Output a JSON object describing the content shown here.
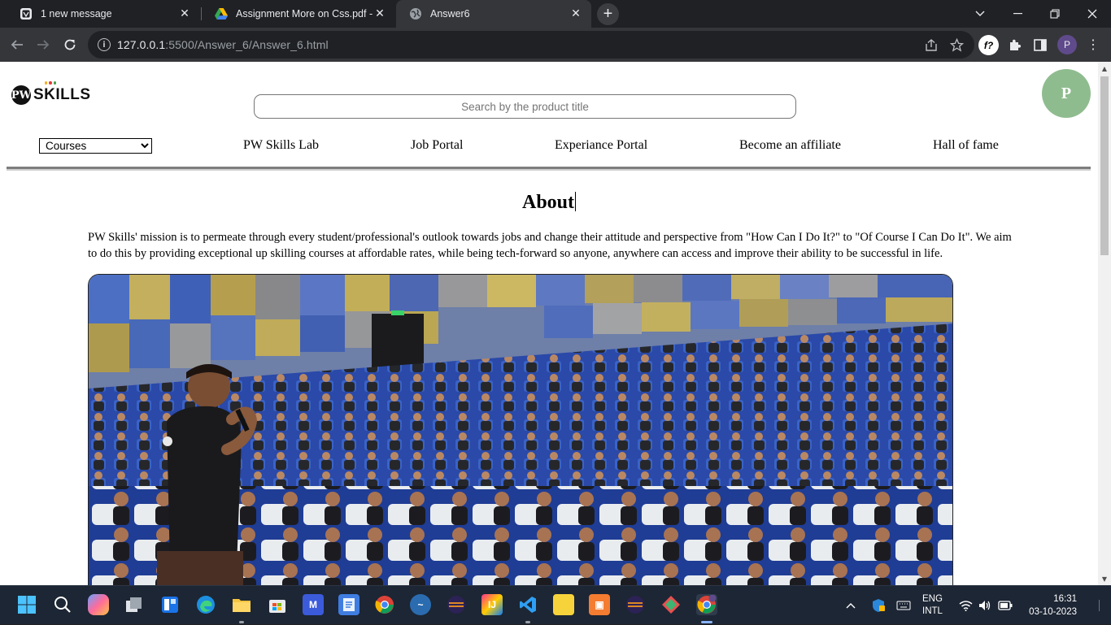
{
  "browser": {
    "tabs": [
      {
        "title": "1 new message",
        "icon": "mail-favicon",
        "active": false
      },
      {
        "title": "Assignment More on Css.pdf - G",
        "icon": "google-drive-favicon",
        "active": false
      },
      {
        "title": "Answer6",
        "icon": "globe-favicon",
        "active": true
      }
    ],
    "new_tab_glyph": "+",
    "window_controls": {
      "dropdown": "⌄",
      "minimize": "—",
      "restore": "❐",
      "close": "✕"
    },
    "url_host": "127.0.0.1",
    "url_rest": ":5500/Answer_6/Answer_6.html",
    "profile_initial": "P",
    "extension_f_label": "f?"
  },
  "page": {
    "logo_text": "SKILLS",
    "logo_mark": "PW",
    "logo_dot_colors": [
      "#f2b01e",
      "#e53935",
      "#43a047"
    ],
    "search_placeholder": "Search by the product title",
    "avatar_initial": "P",
    "avatar_color": "#8fbc8f",
    "courses_select": {
      "selected": "Courses",
      "options": [
        "Courses"
      ]
    },
    "nav_links": [
      "PW Skills Lab",
      "Job Portal",
      "Experiance Portal",
      "Become an affiliate",
      "Hall of fame"
    ],
    "about_heading": "About",
    "about_text": "PW Skills' mission is to permeate through every student/professional's outlook towards jobs and change their attitude and perspective from \"How Can I Do It?\" to \"Of Course I Can Do It\". We aim to do this by providing exceptional up skilling courses at affordable rates, while being tech-forward so anyone, anywhere can access and improve their ability to be successful in life."
  },
  "taskbar": {
    "language_line1": "ENG",
    "language_line2": "INTL",
    "time": "16:31",
    "date": "03-10-2023"
  }
}
